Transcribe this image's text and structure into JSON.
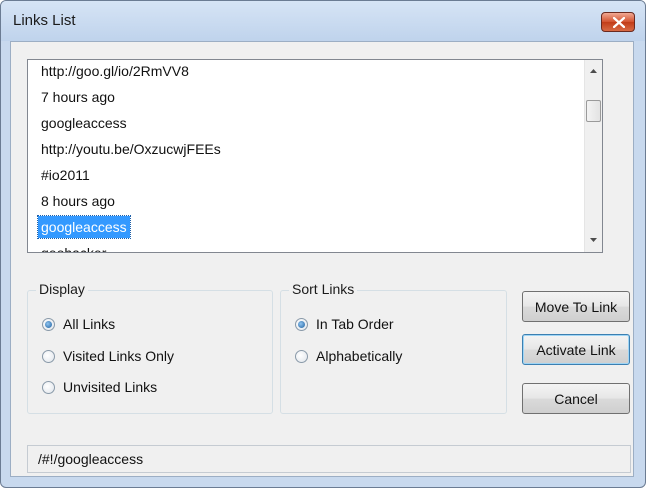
{
  "window": {
    "title": "Links List"
  },
  "colors": {
    "selection": "#3399ff",
    "close_button": "#c8442a"
  },
  "links": {
    "items": [
      "http://goo.gl/io/2RmVV8",
      "7 hours ago",
      "googleaccess",
      "http://youtu.be/OxzucwjFEEs",
      "#io2011",
      "8 hours ago",
      "googleaccess",
      "geohacker"
    ],
    "selected_item": "googleaccess"
  },
  "display": {
    "label": "Display",
    "options": [
      "All Links",
      "Visited Links Only",
      "Unvisited Links"
    ],
    "selected": "All Links"
  },
  "sort": {
    "label": "Sort Links",
    "options": [
      "In Tab Order",
      "Alphabetically"
    ],
    "selected": "In Tab Order"
  },
  "buttons": {
    "move_to_link": "Move To Link",
    "activate_link": "Activate Link",
    "cancel": "Cancel"
  },
  "status": {
    "text": "/#!/googleaccess"
  }
}
